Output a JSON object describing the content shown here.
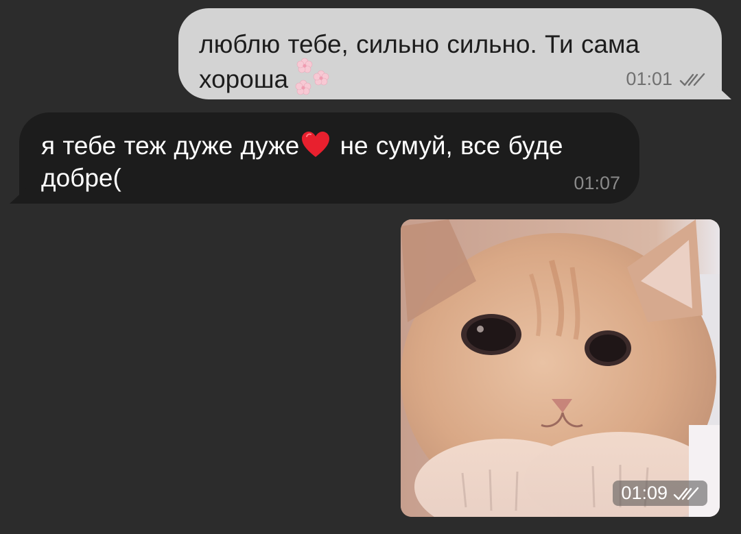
{
  "chat": {
    "messages": [
      {
        "direction": "outgoing",
        "text": "люблю тебе, сильно сильно. Ти сама хороша",
        "emoji": "cherry-blossom-flowers",
        "time": "01:01",
        "status": "read"
      },
      {
        "direction": "incoming",
        "text_part1": "я тебе теж дуже дуже",
        "emoji": "red-heart",
        "text_part2": " не сумуй, все буде добре(",
        "time": "01:07"
      },
      {
        "direction": "outgoing",
        "type": "photo",
        "subject": "kitten",
        "time": "01:09",
        "status": "read"
      }
    ]
  },
  "colors": {
    "background": "#2c2c2c",
    "outgoing_bubble": "#d3d3d3",
    "incoming_bubble": "#1c1c1c"
  }
}
